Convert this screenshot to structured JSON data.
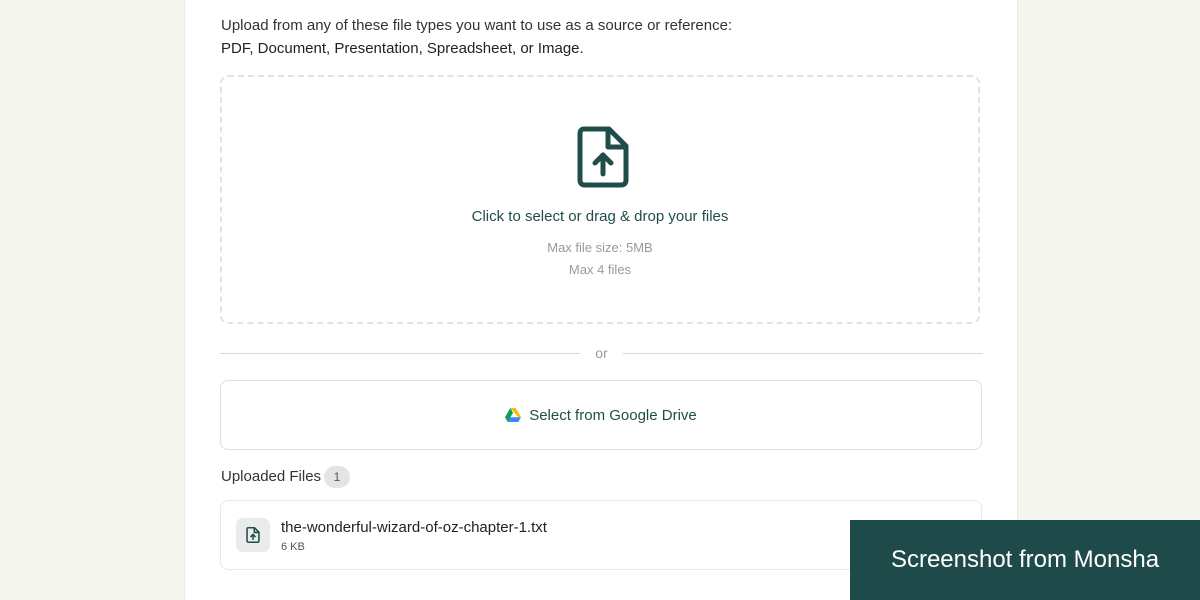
{
  "intro": {
    "line1": "Upload from any of these file types you want to use as a source or reference:",
    "line2": "PDF, Document, Presentation, Spreadsheet, or Image."
  },
  "dropzone": {
    "icon": "file-upload-icon",
    "title": "Click to select or drag & drop your files",
    "max_size": "Max file size: 5MB",
    "max_files": "Max 4 files"
  },
  "divider": {
    "label": "or"
  },
  "google_drive": {
    "icon": "google-drive-icon",
    "label": "Select from Google Drive"
  },
  "uploaded": {
    "title": "Uploaded Files",
    "count": "1",
    "files": [
      {
        "icon": "file-upload-icon",
        "name": "the-wonderful-wizard-of-oz-chapter-1.txt",
        "size": "6 KB"
      }
    ]
  },
  "watermark": "Screenshot from Monsha",
  "colors": {
    "accent": "#1f4e4a",
    "watermark_bg": "#1f4a4a",
    "page_bg": "#f6f6f1"
  }
}
